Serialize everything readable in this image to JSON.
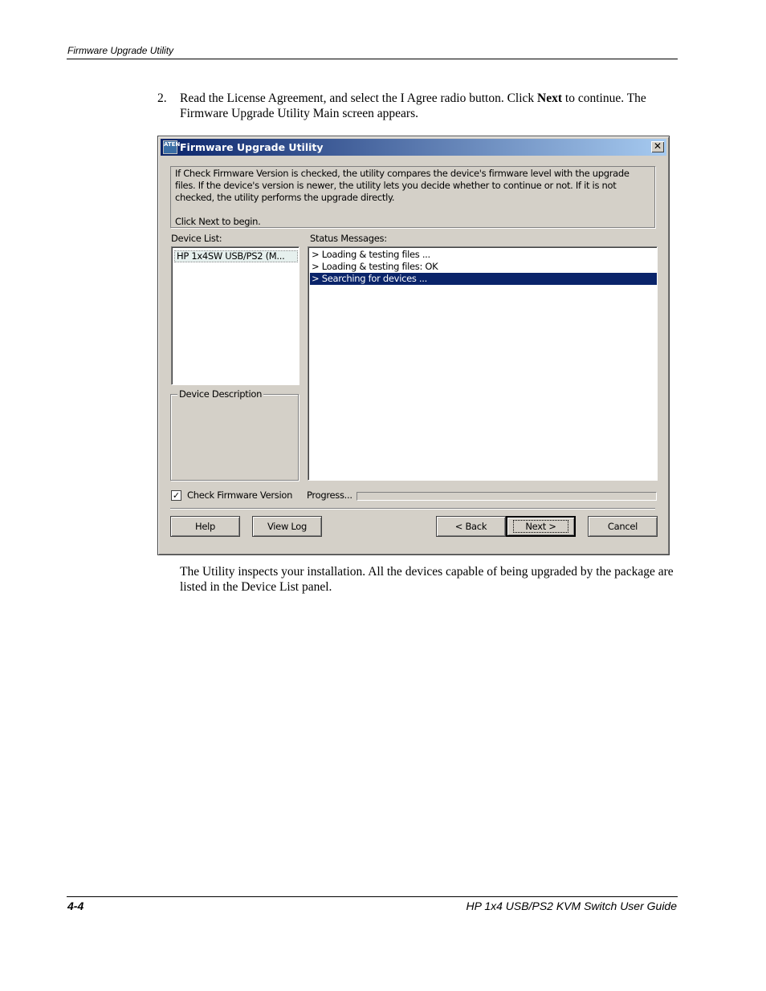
{
  "header": {
    "section_title": "Firmware Upgrade Utility"
  },
  "step": {
    "number": "2.",
    "text_before": "Read the License Agreement, and select the I Agree radio button. Click ",
    "bold": "Next",
    "text_after": " to continue. The Firmware Upgrade Utility Main screen appears."
  },
  "dialog": {
    "title": "Firmware Upgrade Utility",
    "icon_text": "ATEN",
    "close_glyph": "✕",
    "info_lines": [
      "If Check Firmware Version is checked, the utility compares the device's firmware level with the upgrade",
      "files. If the device's version is newer, the utility lets you decide whether to continue or not. If it is not",
      "checked, the utility performs the upgrade directly.",
      "Click Next to begin."
    ],
    "device_list_label": "Device List:",
    "device_items": [
      "HP 1x4SW USB/PS2 (M..."
    ],
    "status_label": "Status Messages:",
    "status_messages": [
      "> Loading & testing files ...",
      "> Loading & testing files: OK",
      "> Searching for devices ..."
    ],
    "selected_status_index": 2,
    "device_description_label": "Device Description",
    "check_firmware_label": "Check Firmware Version",
    "check_firmware_checked": true,
    "check_glyph": "✓",
    "progress_label": "Progress...",
    "progress_fraction": 0,
    "buttons": {
      "help": "Help",
      "view_log": "View Log",
      "back": "< Back",
      "next": "Next >",
      "cancel": "Cancel"
    },
    "colors": {
      "titlebar_start": "#0a246a",
      "titlebar_end": "#a6caf0",
      "face": "#d4d0c8",
      "selection": "#0a246a"
    }
  },
  "paragraph": "The Utility inspects your installation. All the devices capable of being upgraded by the package are listed in the Device List panel.",
  "footer": {
    "page_number": "4-4",
    "guide_title": "HP 1x4 USB/PS2 KVM Switch User Guide"
  }
}
